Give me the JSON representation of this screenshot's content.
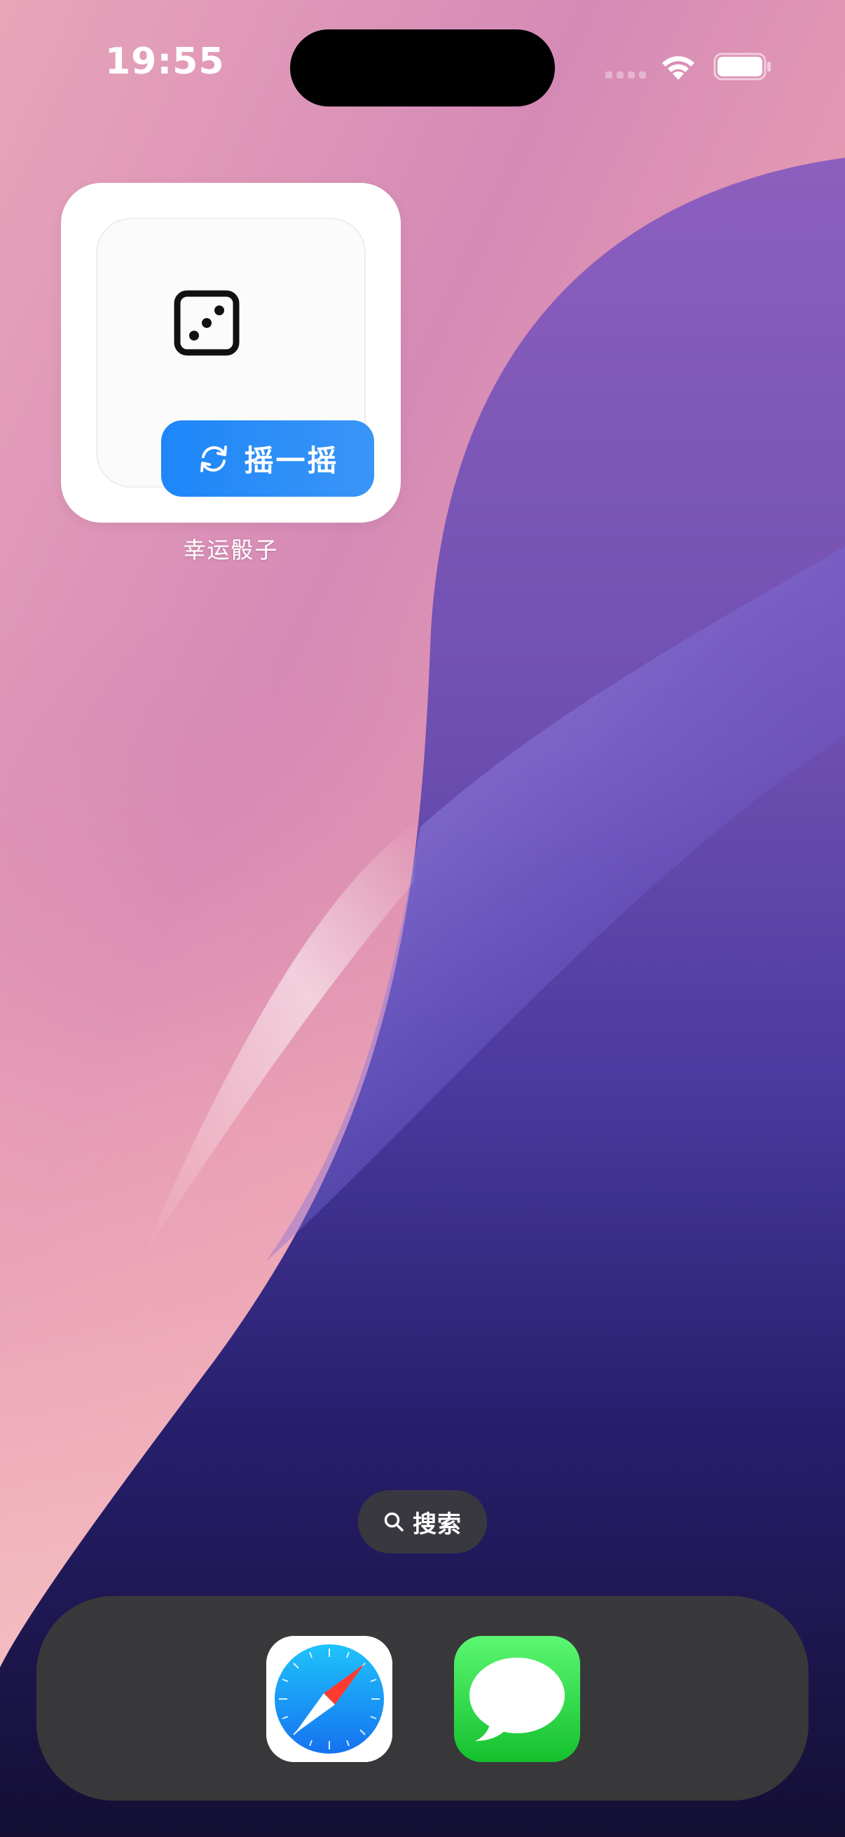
{
  "status_bar": {
    "time": "19:55"
  },
  "widget": {
    "button_label": "摇一摇",
    "caption": "幸运骰子",
    "dice_face": 3,
    "icons": {
      "dice": "dice-three-icon",
      "button": "refresh-icon"
    }
  },
  "search": {
    "label": "搜索",
    "icon": "search-icon"
  },
  "dock": {
    "apps": [
      {
        "icon": "safari-icon"
      },
      {
        "icon": "messages-icon"
      }
    ]
  },
  "colors": {
    "button_blue": "#1d86f9",
    "dock_bg": "#3a3a3a",
    "messages_green": "#28cc40"
  }
}
